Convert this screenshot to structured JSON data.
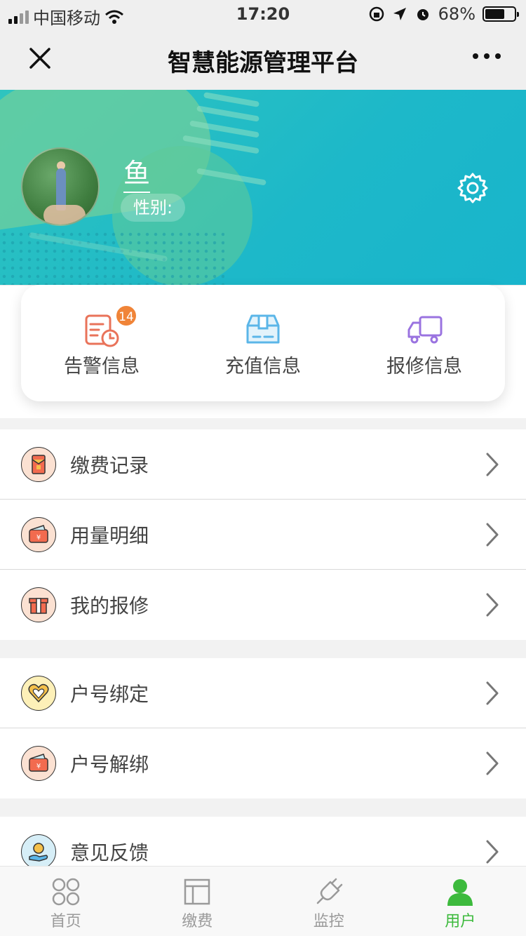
{
  "status_bar": {
    "carrier": "中国移动",
    "time": "17:20",
    "battery_text": "68%",
    "battery_level": 0.68
  },
  "nav": {
    "title": "智慧能源管理平台"
  },
  "profile": {
    "name": "鱼",
    "gender_label": "性别:"
  },
  "quick_actions": [
    {
      "label": "告警信息",
      "badge": "14",
      "icon": "alarm-icon",
      "color": "#e9735a"
    },
    {
      "label": "充值信息",
      "icon": "box-icon",
      "color": "#5bb6e8"
    },
    {
      "label": "报修信息",
      "icon": "truck-icon",
      "color": "#9a73e0"
    }
  ],
  "menu_group_1": [
    {
      "label": "缴费记录",
      "icon": "red-envelope-icon"
    },
    {
      "label": "用量明细",
      "icon": "wallet-icon"
    },
    {
      "label": "我的报修",
      "icon": "gift-icon"
    }
  ],
  "menu_group_2": [
    {
      "label": "户号绑定",
      "icon": "heart-icon"
    },
    {
      "label": "户号解绑",
      "icon": "wallet-icon"
    }
  ],
  "menu_group_3": [
    {
      "label": "意见反馈",
      "icon": "hand-coin-icon"
    }
  ],
  "tabbar": [
    {
      "label": "首页",
      "icon": "home-icon",
      "active": false
    },
    {
      "label": "缴费",
      "icon": "layout-icon",
      "active": false
    },
    {
      "label": "监控",
      "icon": "plug-icon",
      "active": false
    },
    {
      "label": "用户",
      "icon": "user-icon",
      "active": true
    }
  ],
  "colors": {
    "banner": "#1db8c9",
    "active_tab": "#3dba3d",
    "badge": "#f08438"
  }
}
